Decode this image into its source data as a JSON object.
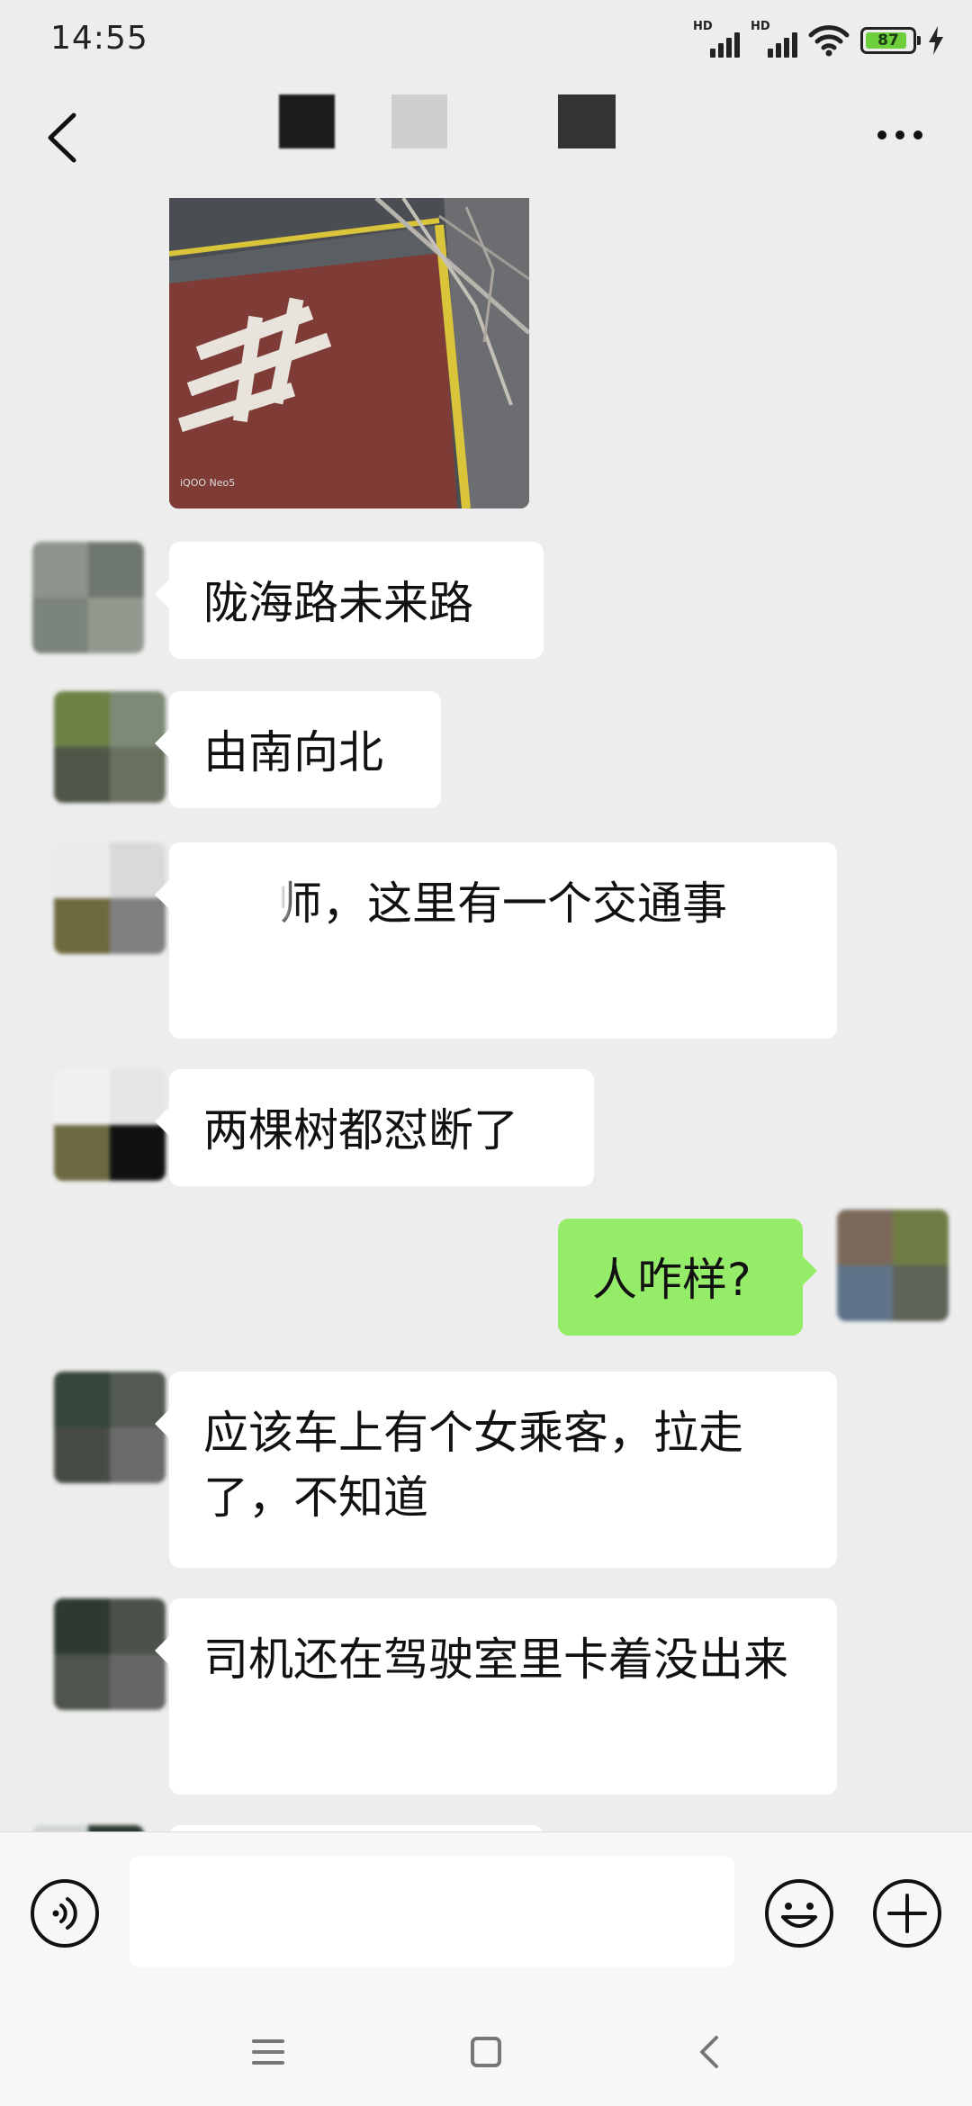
{
  "status_bar": {
    "time": "14:55",
    "signal_1_label": "HD",
    "signal_2_label": "HD",
    "battery_level": "87",
    "icons": [
      "signal-icon",
      "signal-icon",
      "wifi-icon",
      "battery-icon",
      "charging-icon"
    ]
  },
  "header": {
    "title": "",
    "back_icon": "chevron-left-icon",
    "more_icon": "more-dots-icon"
  },
  "messages": [
    {
      "side": "left",
      "type": "image",
      "watermark": "iQOO Neo5"
    },
    {
      "side": "left",
      "type": "text",
      "text": "陇海路未来路"
    },
    {
      "side": "left",
      "type": "text",
      "text": "由南向北"
    },
    {
      "side": "left",
      "type": "text",
      "text": "师，这里有一个交通事"
    },
    {
      "side": "left",
      "type": "text",
      "text": "两棵树都怼断了"
    },
    {
      "side": "right",
      "type": "text",
      "text": "人咋样?"
    },
    {
      "side": "left",
      "type": "text",
      "text": "应该车上有个女乘客，拉走了，不知道"
    },
    {
      "side": "left",
      "type": "text",
      "text": "司机还在驾驶室里卡着没出来"
    }
  ],
  "input_bar": {
    "voice_icon": "voice-icon",
    "text_value": "",
    "emoji_icon": "emoji-icon",
    "plus_icon": "plus-icon"
  },
  "nav_bar": {
    "icons": [
      "menu-icon",
      "home-icon",
      "back-icon"
    ]
  },
  "colors": {
    "background": "#ededed",
    "incoming_bubble": "#ffffff",
    "outgoing_bubble": "#95ec69",
    "battery_fill": "#6ecf3c"
  }
}
